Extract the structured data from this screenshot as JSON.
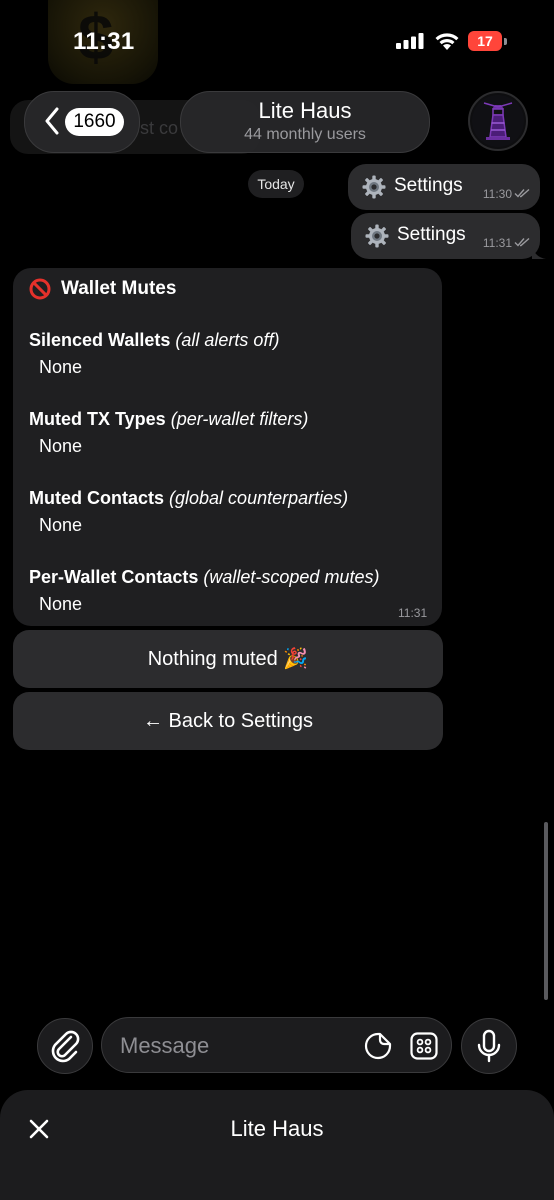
{
  "status_bar": {
    "time": "11:31",
    "battery": "17"
  },
  "header": {
    "unread_count": "1660",
    "title": "Lite Haus",
    "subtitle": "44 monthly users",
    "background_snippet": "st co"
  },
  "chat": {
    "date_separator": "Today",
    "outgoing": [
      {
        "text": "Settings",
        "time": "11:30"
      },
      {
        "text": "Settings",
        "time": "11:31"
      }
    ],
    "incoming": {
      "title": "Wallet Mutes",
      "sections": [
        {
          "label": "Silenced Wallets",
          "note": "(all alerts off)",
          "value": "None"
        },
        {
          "label": "Muted TX Types",
          "note": "(per-wallet filters)",
          "value": "None"
        },
        {
          "label": "Muted Contacts",
          "note": "(global counterparties)",
          "value": "None"
        },
        {
          "label": "Per-Wallet Contacts",
          "note": "(wallet-scoped mutes)",
          "value": "None"
        }
      ],
      "time": "11:31"
    },
    "keyboard": [
      {
        "label": "Nothing muted 🎉"
      },
      {
        "label": "← Back to Settings"
      }
    ]
  },
  "composer": {
    "placeholder": "Message"
  },
  "bottom_sheet": {
    "title": "Lite Haus"
  },
  "colors": {
    "background": "#000000",
    "bubble_incoming": "#1f1f21",
    "bubble_outgoing": "#2c2c2e",
    "battery_low": "#ff453a",
    "avatar_accent": "#6b2fa0"
  },
  "icons": {
    "back": "chevron-left-icon",
    "settings": "gear-icon",
    "wallet_mutes": "no-entry-icon",
    "attach": "paperclip-icon",
    "sticker": "sticker-icon",
    "apps": "apps-grid-icon",
    "mic": "microphone-icon",
    "close": "close-icon",
    "read_status": "double-check-icon"
  }
}
